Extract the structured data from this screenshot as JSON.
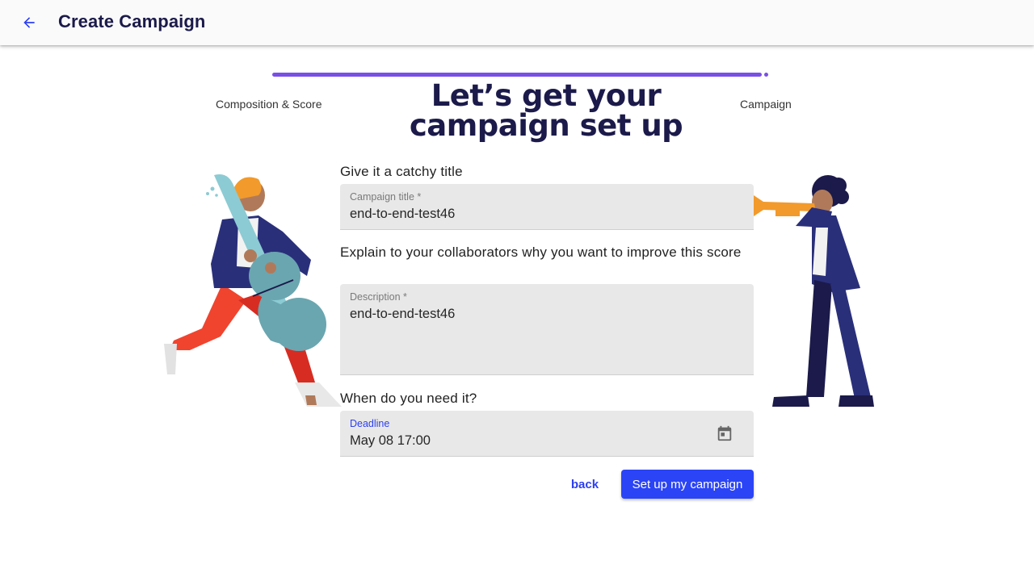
{
  "appbar": {
    "back_icon": "arrow-back-icon",
    "title": "Create Campaign"
  },
  "stepper": {
    "progress": 1.0,
    "steps": [
      "Composition & Score",
      "Campaign"
    ],
    "color": "#7a4fe6"
  },
  "headline": "Let’s get your campaign set up",
  "form": {
    "title_section": "Give it a catchy title",
    "title_field": {
      "label": "Campaign title *",
      "value": "end-to-end-test46"
    },
    "description_section": "Explain to your collaborators why you want to improve this score",
    "description_field": {
      "label": "Description *",
      "value": "end-to-end-test46"
    },
    "deadline_section": "When do you need it?",
    "deadline_field": {
      "label": "Deadline",
      "value": "May 08 17:00",
      "icon": "calendar-icon"
    }
  },
  "actions": {
    "back_label": "back",
    "submit_label": "Set up my campaign"
  },
  "colors": {
    "primary": "#2b44f6",
    "heading": "#1b1a4a",
    "accent_purple": "#7a4fe6"
  }
}
